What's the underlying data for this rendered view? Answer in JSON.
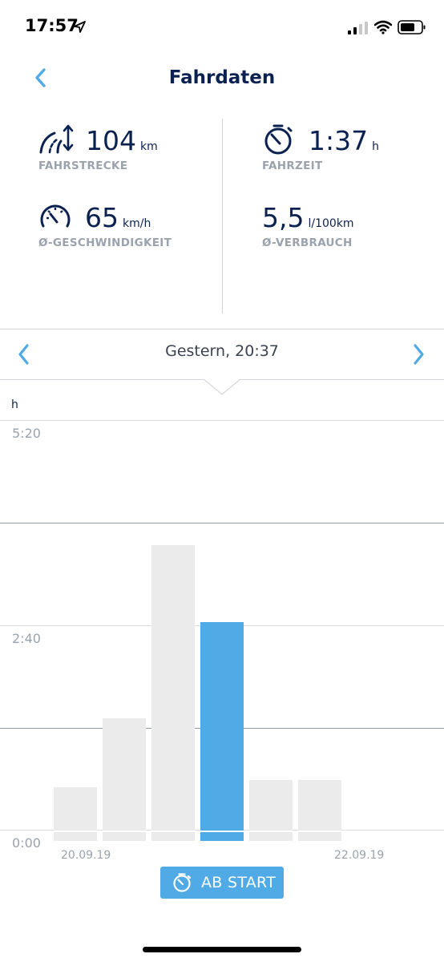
{
  "status_bar": {
    "time": "17:57",
    "icons": [
      "location-arrow-icon",
      "signal-icon",
      "wifi-icon",
      "battery-icon"
    ]
  },
  "header": {
    "title": "Fahrdaten",
    "back_icon": "chevron-left-icon"
  },
  "stats": {
    "distance": {
      "value": "104",
      "unit": "km",
      "label": "FAHRSTRECKE",
      "icon": "road-icon"
    },
    "duration": {
      "value": "1:37",
      "unit": "h",
      "label": "FAHRZEIT",
      "icon": "stopwatch-icon"
    },
    "speed": {
      "value": "65",
      "unit": "km/h",
      "label": "Ø-GESCHWINDIGKEIT",
      "icon": "speedometer-icon"
    },
    "consumption": {
      "value": "5,5",
      "unit": "l/100km",
      "label": "Ø-VERBRAUCH"
    }
  },
  "date_selector": {
    "label": "Gestern, 20:37",
    "prev_icon": "chevron-left-icon",
    "next_icon": "chevron-right-icon"
  },
  "colors": {
    "accent": "#4faae6",
    "navy": "#0b2251",
    "bar": "#ebebeb",
    "muted": "#9aa2ad"
  },
  "chart_data": {
    "type": "bar",
    "unit_label": "h",
    "y_tick_labels": [
      "5:20",
      "2:40",
      "0:00"
    ],
    "ylim": [
      0,
      5.333
    ],
    "x_tick_labels": [
      "20.09.19",
      "22.09.19"
    ],
    "values": [
      0.55,
      1.45,
      3.7,
      2.7,
      0.65,
      0.65
    ],
    "selected_index": 3,
    "grid": true
  },
  "action": {
    "label": "AB START",
    "icon": "stopwatch-icon"
  }
}
